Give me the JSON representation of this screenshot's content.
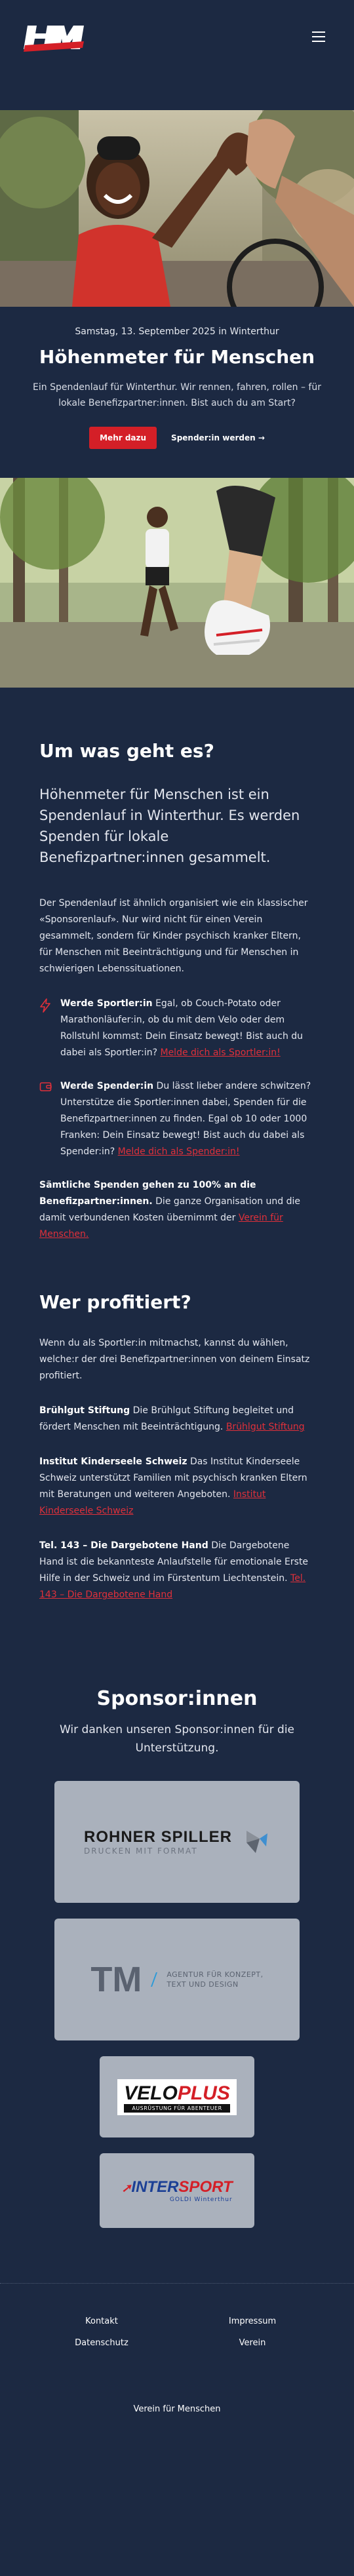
{
  "header": {
    "logo_text": "HFM",
    "menu_icon": "hamburger-icon"
  },
  "hero": {
    "date": "Samstag, 13. September 2025 in Winterthur",
    "title": "Höhenmeter für Menschen",
    "lead": "Ein Spendenlauf für Winterthur. Wir rennen, fahren, rollen – für lokale Benefizpartner:innen. Bist auch du am Start?",
    "primary_button": "Mehr dazu",
    "secondary_button": "Spender:in werden →"
  },
  "about": {
    "heading": "Um was geht es?",
    "lead": "Höhenmeter für Menschen ist ein Spendenlauf in Winterthur. Es werden Spenden für lokale Benefizpartner:innen gesammelt.",
    "paragraph": "Der Spendenlauf ist ähnlich organisiert wie ein klassischer «Sponsorenlauf». Nur wird nicht für einen Verein gesammelt, sondern für Kinder psychisch kranker Eltern, für Menschen mit Beeinträchtigung und für Menschen in schwierigen Lebenssituationen.",
    "features": [
      {
        "icon": "lightning-icon",
        "title": "Werde Sportler:in",
        "text": "Egal, ob Couch-Potato oder Marathonläufer:in, ob du mit dem Velo oder dem Rollstuhl kommst: Dein Einsatz bewegt! Bist auch du dabei als Sportler:in?",
        "link": "Melde dich als Sportler:in!"
      },
      {
        "icon": "wallet-icon",
        "title": "Werde Spender:in",
        "text": "Du lässt lieber andere schwitzen? Unterstütze die Sportler:innen dabei, Spenden für die Benefizpartner:innen zu finden. Egal ob 10 oder 1000 Franken: Dein Einsatz bewegt! Bist auch du dabei als Spender:in?",
        "link": "Melde dich als Spender:in!"
      }
    ],
    "donation_bold": "Sämtliche Spenden gehen zu 100% an die Benefizpartner:innen.",
    "donation_text": "Die ganze Organisation und die damit verbundenen Kosten übernimmt der",
    "donation_link": "Verein für Menschen."
  },
  "beneficiaries": {
    "heading": "Wer profitiert?",
    "intro": "Wenn du als Sportler:in mitmachst, kannst du wählen, welche:r der drei Benefizpartner:innen von deinem Einsatz profitiert.",
    "partners": [
      {
        "name": "Brühlgut Stiftung",
        "text": "Die Brühlgut Stiftung begleitet und fördert Menschen mit Beeinträchtigung.",
        "link": "Brühlgut Stiftung"
      },
      {
        "name": "Institut Kinderseele Schweiz",
        "text": "Das Institut Kinderseele Schweiz unterstützt Familien mit psychisch kranken Eltern mit Beratungen und weiteren Angeboten.",
        "link": "Institut Kinderseele Schweiz"
      },
      {
        "name": "Tel. 143 – Die Dargebotene Hand",
        "text": "Die Dargebotene Hand ist die bekannteste Anlaufstelle für emotionale Erste Hilfe in der Schweiz und im Fürstentum Liechtenstein.",
        "link": "Tel. 143 – Die Dargebotene Hand"
      }
    ]
  },
  "sponsors": {
    "heading": "Sponsor:innen",
    "subtitle": "Wir danken unseren Sponsor:innen für die Unterstützung.",
    "rohner": {
      "name": "ROHNER SPILLER",
      "tagline": "DRUCKEN MIT FORMAT"
    },
    "tm": {
      "mark": "TM",
      "text_line1": "AGENTUR FÜR KONZEPT,",
      "text_line2": "TEXT UND DESIGN"
    },
    "velo": {
      "name_a": "VELO",
      "name_b": "PLUS",
      "sub": "AUSRÜSTUNG FÜR ABENTEUER"
    },
    "intersport": {
      "name_a": "INTER",
      "name_b": "SPORT",
      "sub": "GOLDI Winterthur"
    }
  },
  "footer": {
    "links": [
      "Kontakt",
      "Impressum",
      "Datenschutz",
      "Verein"
    ],
    "owner": "Verein für Menschen"
  },
  "colors": {
    "background": "#1c2942",
    "accent": "#d41f27"
  }
}
